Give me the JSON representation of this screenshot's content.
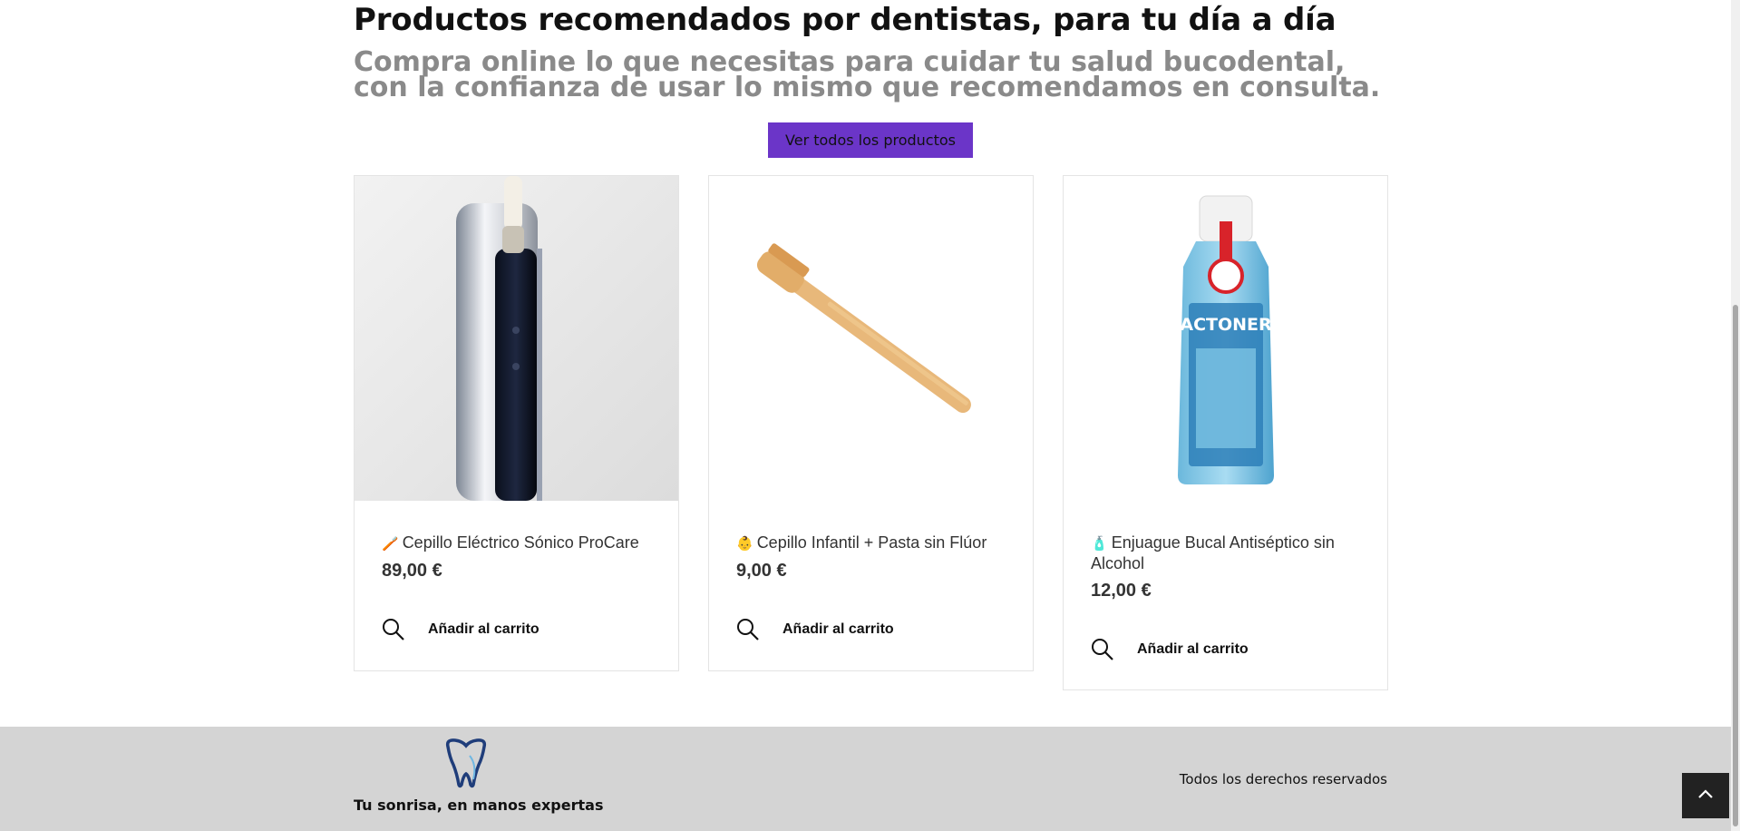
{
  "section": {
    "title": "Productos recomendados por dentistas, para tu día a día",
    "subtitle": "Compra online lo que necesitas para cuidar tu salud bucodental, con la confianza de usar lo mismo que recomendamos en consulta.",
    "cta_label": "Ver todos los productos"
  },
  "products": [
    {
      "emoji": "🪥",
      "name": "Cepillo Eléctrico Sónico ProCare",
      "price": "89,00 €",
      "add_to_cart": "Añadir al carrito",
      "image": "electric-toothbrush-photo"
    },
    {
      "emoji": "👶",
      "name": "Cepillo Infantil + Pasta sin Flúor",
      "price": "9,00 €",
      "add_to_cart": "Añadir al carrito",
      "image": "bamboo-toothbrush-photo"
    },
    {
      "emoji": "🧴",
      "name": "Enjuague Bucal Antiséptico sin Alcohol",
      "price": "12,00 €",
      "add_to_cart": "Añadir al carrito",
      "image": "mouthwash-bottle-photo",
      "bottle_label": "ACTONER"
    }
  ],
  "footer": {
    "tagline": "Tu sonrisa, en manos expertas",
    "rights": "Todos los derechos reservados"
  },
  "colors": {
    "accent": "#6b35c8",
    "footer_bg": "#d4d4d4",
    "scroll_top_bg": "#222222",
    "logo": "#1f3d7a"
  }
}
